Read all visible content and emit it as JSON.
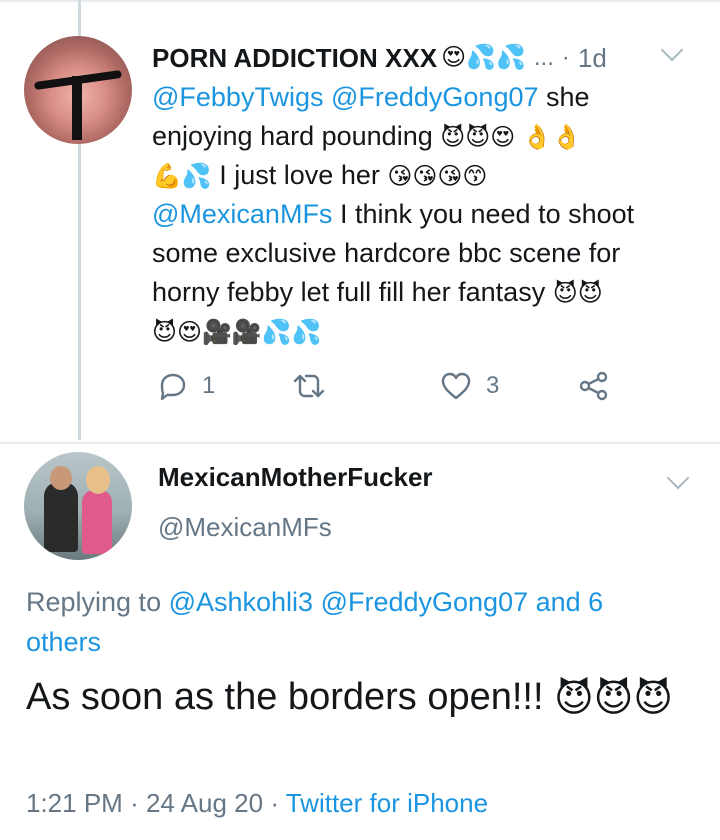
{
  "tweet1": {
    "display_name": "PORN ADDICTION XXX",
    "name_emojis": "😍💦💦",
    "more": "...",
    "time": "1d",
    "lines": [
      {
        "parts": [
          {
            "t": "@FebbyTwigs @FreddyGong07",
            "m": true
          },
          {
            "t": " she",
            "m": false
          }
        ]
      },
      {
        "parts": [
          {
            "t": "enjoying hard pounding ",
            "m": false
          },
          {
            "t": "😈😈😍 👌👌",
            "e": true
          }
        ]
      },
      {
        "parts": [
          {
            "t": "💪💦",
            "e": true
          },
          {
            "t": " I just love her ",
            "m": false
          },
          {
            "t": "😘😘😘😙",
            "e": true
          }
        ]
      },
      {
        "parts": [
          {
            "t": "@MexicanMFs",
            "m": true
          },
          {
            "t": "  I think you need to shoot",
            "m": false
          }
        ]
      },
      {
        "parts": [
          {
            "t": "some exclusive hardcore bbc scene for",
            "m": false
          }
        ]
      },
      {
        "parts": [
          {
            "t": "horny febby let full fill her fantasy ",
            "m": false
          },
          {
            "t": "😈😈",
            "e": true
          }
        ]
      },
      {
        "parts": [
          {
            "t": "😈😍🎥🎥💦💦",
            "e": true
          }
        ]
      }
    ],
    "reply_count": "1",
    "retweet_count": "",
    "like_count": "3"
  },
  "icons": {
    "reply": "reply-icon",
    "retweet": "retweet-icon",
    "like": "heart-icon",
    "share": "share-icon",
    "menu": "chevron-down-icon"
  },
  "tweet2": {
    "display_name": "MexicanMotherFucker",
    "handle": "@MexicanMFs",
    "replying_prefix": "Replying to ",
    "replying_mentions": "@Ashkohli3 @FreddyGong07 and 6 others",
    "text": "As soon as the borders open!!! ",
    "text_emojis": "😈😈😈",
    "time": "1:21 PM",
    "date": "24 Aug 20",
    "source": "Twitter for iPhone"
  },
  "colors": {
    "link": "#1b95e0",
    "muted": "#657786",
    "text": "#14171a"
  }
}
